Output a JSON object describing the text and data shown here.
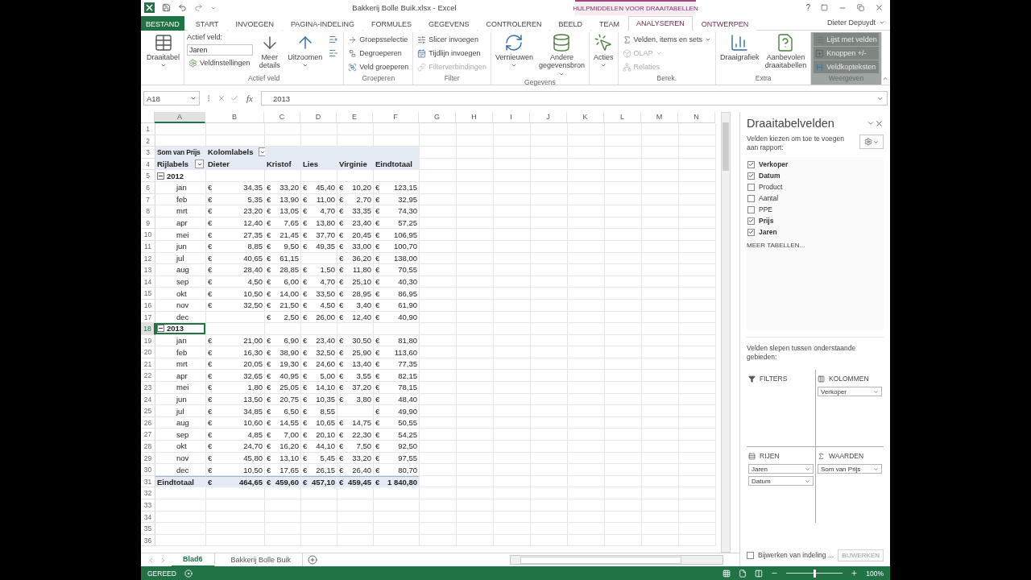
{
  "window": {
    "title": "Bakkerij Bolle Buik.xlsx - Excel",
    "context_header": "HULPMIDDELEN VOOR DRAAITABELLEN",
    "help": "?",
    "user": "Dieter Depuydt"
  },
  "tabs": [
    {
      "label": "BESTAND",
      "kind": "file",
      "selected": false
    },
    {
      "label": "START",
      "kind": "normal",
      "selected": false
    },
    {
      "label": "INVOEGEN",
      "kind": "normal",
      "selected": false
    },
    {
      "label": "PAGINA-INDELING",
      "kind": "normal",
      "selected": false
    },
    {
      "label": "FORMULES",
      "kind": "normal",
      "selected": false
    },
    {
      "label": "GEGEVENS",
      "kind": "normal",
      "selected": false
    },
    {
      "label": "CONTROLEREN",
      "kind": "normal",
      "selected": false
    },
    {
      "label": "BEELD",
      "kind": "normal",
      "selected": false
    },
    {
      "label": "TEAM",
      "kind": "normal",
      "selected": false
    },
    {
      "label": "ANALYSEREN",
      "kind": "context",
      "selected": true
    },
    {
      "label": "ONTWERPEN",
      "kind": "context",
      "selected": false
    }
  ],
  "ribbon": {
    "groups": [
      {
        "items": [
          {
            "kind": "large",
            "label": "Draaitabel",
            "dropdown": true,
            "disabled": false
          }
        ]
      },
      {
        "label": "Actief veld",
        "items": [
          {
            "kind": "field",
            "label": "Actief veld:",
            "value": "Jaren"
          },
          {
            "kind": "small",
            "label": "Veldinstellingen",
            "dropdown": false,
            "disabled": false
          },
          {
            "kind": "large",
            "label": "Meer details",
            "dropdown": false,
            "disabled": false
          },
          {
            "kind": "large",
            "label": "Uitzoomen",
            "dropdown": true,
            "disabled": false
          },
          {
            "kind": "icon"
          },
          {
            "kind": "icon"
          }
        ]
      },
      {
        "label": "Groeperen",
        "items": [
          {
            "kind": "small",
            "label": "Groepsselectie",
            "dropdown": false,
            "disabled": false
          },
          {
            "kind": "small",
            "label": "Degroeperen",
            "dropdown": false,
            "disabled": false
          },
          {
            "kind": "small",
            "label": "Veld groeperen",
            "dropdown": false,
            "disabled": false
          }
        ]
      },
      {
        "label": "Filter",
        "items": [
          {
            "kind": "small",
            "label": "Slicer invoegen",
            "dropdown": false,
            "disabled": false
          },
          {
            "kind": "small",
            "label": "Tijdlijn invoegen",
            "dropdown": false,
            "disabled": false
          },
          {
            "kind": "small",
            "label": "Filterverbindingen",
            "dropdown": false,
            "disabled": true
          }
        ]
      },
      {
        "label": "Gegevens",
        "items": [
          {
            "kind": "large",
            "label": "Vernieuwen",
            "dropdown": true,
            "disabled": false
          },
          {
            "kind": "large",
            "label": "Andere gegevensbron",
            "dropdown": true,
            "disabled": false
          }
        ]
      },
      {
        "items": [
          {
            "kind": "large",
            "label": "Acties",
            "dropdown": true,
            "disabled": false
          }
        ]
      },
      {
        "label": "Berek.",
        "items": [
          {
            "kind": "small",
            "label": "Velden, items en sets",
            "dropdown": true,
            "disabled": false
          },
          {
            "kind": "small",
            "label": "OLAP",
            "dropdown": true,
            "disabled": true
          },
          {
            "kind": "small",
            "label": "Relaties",
            "dropdown": false,
            "disabled": true
          }
        ]
      },
      {
        "label": "Extra",
        "items": [
          {
            "kind": "large",
            "label": "Draaigrafiek",
            "dropdown": false,
            "disabled": false
          },
          {
            "kind": "large",
            "label": "Aanbevolen draaitabellen",
            "dropdown": false,
            "disabled": false
          }
        ]
      },
      {
        "label": "Weergeven",
        "items": [
          {
            "kind": "toggle",
            "label": "Lijst met velden",
            "on": true
          },
          {
            "kind": "toggle",
            "label": "Knoppen +/-",
            "on": true
          },
          {
            "kind": "toggle",
            "label": "Veldkopteksten",
            "on": true
          }
        ]
      }
    ]
  },
  "formula_bar": {
    "name_box": "A18",
    "fx": "fx",
    "value": "2013"
  },
  "sheet": {
    "columns": [
      "A",
      "B",
      "C",
      "D",
      "E",
      "F",
      "G",
      "H",
      "I",
      "J",
      "K",
      "L",
      "M",
      "N"
    ],
    "row_numbers": [
      "1",
      "2",
      "3",
      "4",
      "5",
      "6",
      "7",
      "8",
      "9",
      "10",
      "11",
      "12",
      "13",
      "14",
      "15",
      "16",
      "17",
      "18",
      "19",
      "20",
      "21",
      "22",
      "23",
      "24",
      "25",
      "26",
      "27",
      "28",
      "29",
      "30",
      "31",
      "32",
      "33",
      "34",
      "35",
      "36"
    ]
  },
  "pivot": {
    "corner": "Som van Prijs",
    "column_labels": "Kolomlabels",
    "row_labels": "Rijlabels",
    "columns": [
      "Dieter",
      "Kristof",
      "Lies",
      "Virginie",
      "Eindtotaal"
    ],
    "groups": [
      {
        "label": "2012",
        "expanded": true,
        "selected": false,
        "rows": [
          {
            "label": "jan",
            "cells": [
              [
                "€",
                "34,35"
              ],
              [
                "€",
                "33,20"
              ],
              [
                "€",
                "45,40"
              ],
              [
                "€",
                "10,20"
              ],
              [
                "€",
                "123,15"
              ]
            ]
          },
          {
            "label": "feb",
            "cells": [
              [
                "€",
                "5,35"
              ],
              [
                "€",
                "13,90"
              ],
              [
                "€",
                "11,00"
              ],
              [
                "€",
                "2,70"
              ],
              [
                "€",
                "32,95"
              ]
            ]
          },
          {
            "label": "mrt",
            "cells": [
              [
                "€",
                "23,20"
              ],
              [
                "€",
                "13,05"
              ],
              [
                "€",
                "4,70"
              ],
              [
                "€",
                "33,35"
              ],
              [
                "€",
                "74,30"
              ]
            ]
          },
          {
            "label": "apr",
            "cells": [
              [
                "€",
                "12,40"
              ],
              [
                "€",
                "7,65"
              ],
              [
                "€",
                "13,80"
              ],
              [
                "€",
                "23,40"
              ],
              [
                "€",
                "57,25"
              ]
            ]
          },
          {
            "label": "mei",
            "cells": [
              [
                "€",
                "27,35"
              ],
              [
                "€",
                "21,45"
              ],
              [
                "€",
                "37,70"
              ],
              [
                "€",
                "20,45"
              ],
              [
                "€",
                "106,95"
              ]
            ]
          },
          {
            "label": "jun",
            "cells": [
              [
                "€",
                "8,85"
              ],
              [
                "€",
                "9,50"
              ],
              [
                "€",
                "49,35"
              ],
              [
                "€",
                "33,00"
              ],
              [
                "€",
                "100,70"
              ]
            ]
          },
          {
            "label": "jul",
            "cells": [
              [
                "€",
                "40,65"
              ],
              [
                "€",
                "61,15"
              ],
              null,
              [
                "€",
                "36,20"
              ],
              [
                "€",
                "138,00"
              ]
            ]
          },
          {
            "label": "aug",
            "cells": [
              [
                "€",
                "28,40"
              ],
              [
                "€",
                "28,85"
              ],
              [
                "€",
                "1,50"
              ],
              [
                "€",
                "11,80"
              ],
              [
                "€",
                "70,55"
              ]
            ]
          },
          {
            "label": "sep",
            "cells": [
              [
                "€",
                "4,50"
              ],
              [
                "€",
                "6,00"
              ],
              [
                "€",
                "4,70"
              ],
              [
                "€",
                "25,10"
              ],
              [
                "€",
                "40,30"
              ]
            ]
          },
          {
            "label": "okt",
            "cells": [
              [
                "€",
                "10,50"
              ],
              [
                "€",
                "14,00"
              ],
              [
                "€",
                "33,50"
              ],
              [
                "€",
                "28,95"
              ],
              [
                "€",
                "86,95"
              ]
            ]
          },
          {
            "label": "nov",
            "cells": [
              [
                "€",
                "32,50"
              ],
              [
                "€",
                "21,50"
              ],
              [
                "€",
                "4,50"
              ],
              [
                "€",
                "3,40"
              ],
              [
                "€",
                "61,90"
              ]
            ]
          },
          {
            "label": "dec",
            "cells": [
              null,
              [
                "€",
                "2,50"
              ],
              [
                "€",
                "26,00"
              ],
              [
                "€",
                "12,40"
              ],
              [
                "€",
                "40,90"
              ]
            ]
          }
        ]
      },
      {
        "label": "2013",
        "expanded": true,
        "selected": true,
        "rows": [
          {
            "label": "jan",
            "cells": [
              [
                "€",
                "21,00"
              ],
              [
                "€",
                "6,90"
              ],
              [
                "€",
                "23,40"
              ],
              [
                "€",
                "30,50"
              ],
              [
                "€",
                "81,80"
              ]
            ]
          },
          {
            "label": "feb",
            "cells": [
              [
                "€",
                "16,30"
              ],
              [
                "€",
                "38,90"
              ],
              [
                "€",
                "32,50"
              ],
              [
                "€",
                "25,90"
              ],
              [
                "€",
                "113,60"
              ]
            ]
          },
          {
            "label": "mrt",
            "cells": [
              [
                "€",
                "20,05"
              ],
              [
                "€",
                "19,30"
              ],
              [
                "€",
                "24,60"
              ],
              [
                "€",
                "13,40"
              ],
              [
                "€",
                "77,35"
              ]
            ]
          },
          {
            "label": "apr",
            "cells": [
              [
                "€",
                "32,65"
              ],
              [
                "€",
                "40,95"
              ],
              [
                "€",
                "5,00"
              ],
              [
                "€",
                "3,55"
              ],
              [
                "€",
                "82,15"
              ]
            ]
          },
          {
            "label": "mei",
            "cells": [
              [
                "€",
                "1,80"
              ],
              [
                "€",
                "25,05"
              ],
              [
                "€",
                "14,10"
              ],
              [
                "€",
                "37,20"
              ],
              [
                "€",
                "78,15"
              ]
            ]
          },
          {
            "label": "jun",
            "cells": [
              [
                "€",
                "13,50"
              ],
              [
                "€",
                "20,75"
              ],
              [
                "€",
                "10,35"
              ],
              [
                "€",
                "3,80"
              ],
              [
                "€",
                "48,40"
              ]
            ]
          },
          {
            "label": "jul",
            "cells": [
              [
                "€",
                "34,85"
              ],
              [
                "€",
                "6,50"
              ],
              [
                "€",
                "8,55"
              ],
              null,
              [
                "€",
                "49,90"
              ]
            ]
          },
          {
            "label": "aug",
            "cells": [
              [
                "€",
                "10,60"
              ],
              [
                "€",
                "14,55"
              ],
              [
                "€",
                "10,65"
              ],
              [
                "€",
                "14,75"
              ],
              [
                "€",
                "50,55"
              ]
            ]
          },
          {
            "label": "sep",
            "cells": [
              [
                "€",
                "4,85"
              ],
              [
                "€",
                "7,00"
              ],
              [
                "€",
                "20,10"
              ],
              [
                "€",
                "22,30"
              ],
              [
                "€",
                "54,25"
              ]
            ]
          },
          {
            "label": "okt",
            "cells": [
              [
                "€",
                "24,70"
              ],
              [
                "€",
                "16,20"
              ],
              [
                "€",
                "44,10"
              ],
              [
                "€",
                "7,50"
              ],
              [
                "€",
                "92,50"
              ]
            ]
          },
          {
            "label": "nov",
            "cells": [
              [
                "€",
                "45,80"
              ],
              [
                "€",
                "13,10"
              ],
              [
                "€",
                "5,45"
              ],
              [
                "€",
                "33,20"
              ],
              [
                "€",
                "97,55"
              ]
            ]
          },
          {
            "label": "dec",
            "cells": [
              [
                "€",
                "10,50"
              ],
              [
                "€",
                "17,65"
              ],
              [
                "€",
                "26,15"
              ],
              [
                "€",
                "26,40"
              ],
              [
                "€",
                "80,70"
              ]
            ]
          }
        ]
      }
    ],
    "total": {
      "label": "Eindtotaal",
      "cells": [
        [
          "€",
          "464,65"
        ],
        [
          "€",
          "459,60"
        ],
        [
          "€",
          "457,10"
        ],
        [
          "€",
          "459,45"
        ],
        [
          "€",
          "1 840,80"
        ]
      ]
    }
  },
  "sheet_tabs": [
    {
      "label": "Blad6",
      "selected": true
    },
    {
      "label": "Bakkerij Bolle Buik",
      "selected": false
    }
  ],
  "field_pane": {
    "title": "Draaitabelvelden",
    "subtitle": "Velden kiezen om toe te voegen aan rapport:",
    "fields": [
      {
        "label": "Verkoper",
        "checked": true
      },
      {
        "label": "Datum",
        "checked": true
      },
      {
        "label": "Product",
        "checked": false
      },
      {
        "label": "Aantal",
        "checked": false
      },
      {
        "label": "PPE",
        "checked": false
      },
      {
        "label": "Prijs",
        "checked": true
      },
      {
        "label": "Jaren",
        "checked": true
      }
    ],
    "more": "MEER TABELLEN...",
    "drag_hint": "Velden slepen tussen onderstaande gebieden:",
    "areas": [
      {
        "kind": "filters",
        "label": "FILTERS"
      },
      {
        "kind": "columns",
        "label": "KOLOMMEN",
        "items": [
          "Verkoper"
        ]
      },
      {
        "kind": "rows",
        "label": "RIJEN",
        "items": [
          "Jaren",
          "Datum"
        ]
      },
      {
        "kind": "values",
        "label": "WAARDEN",
        "items": [
          "Som van Prijs"
        ]
      }
    ],
    "defer": {
      "label": "Bijwerken van indeling ...",
      "checked": false
    },
    "update_button": {
      "label": "BIJWERKEN",
      "disabled": true
    }
  },
  "status_bar": {
    "status": "GEREED",
    "zoom": {
      "level": 0.5,
      "label": "100%"
    }
  }
}
